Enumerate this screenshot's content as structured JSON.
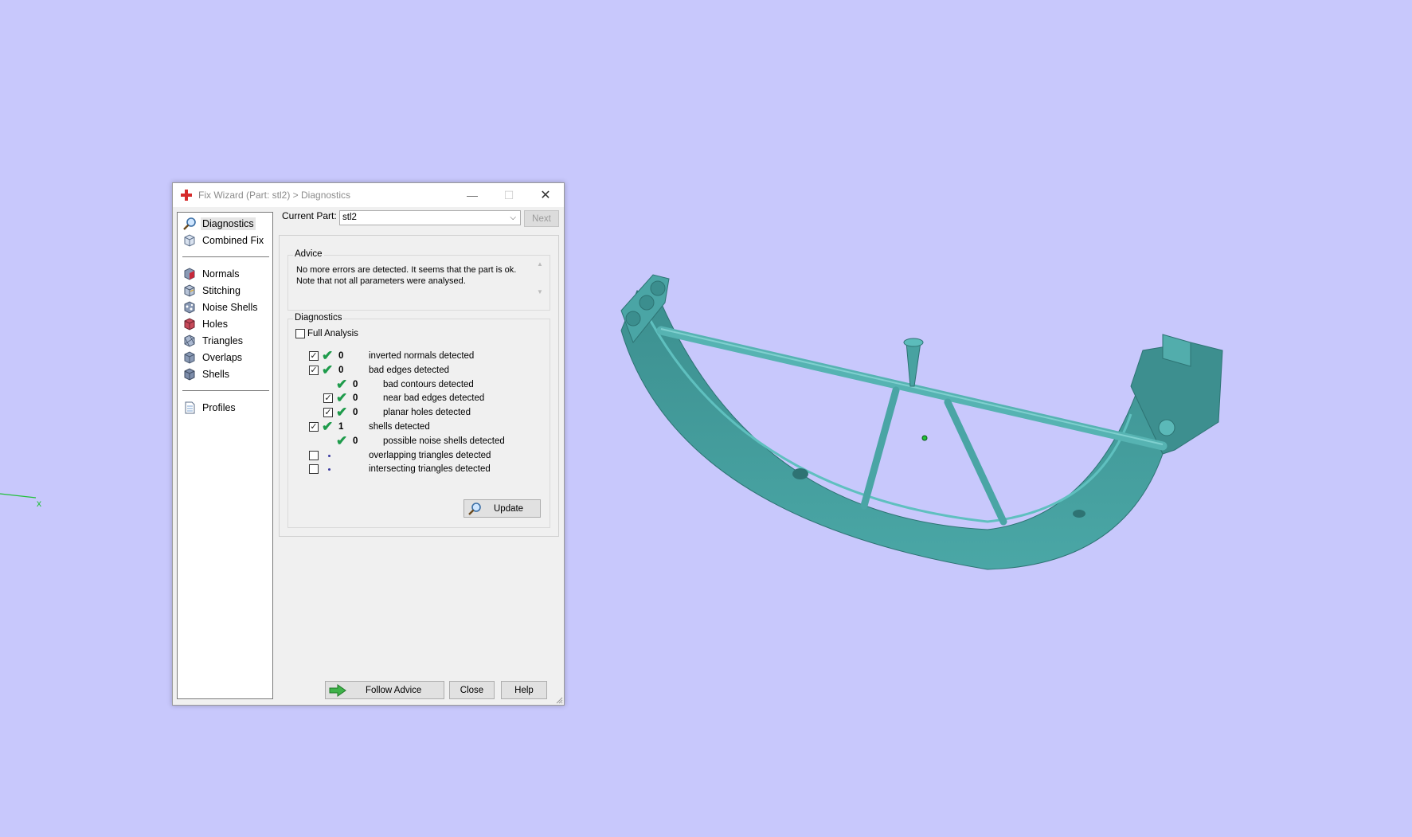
{
  "viewport": {
    "background": "#c8c8fc",
    "axis_label": "x",
    "model_color": "#3f9b9b"
  },
  "dialog": {
    "title": "Fix Wizard (Part: stl2) > Diagnostics",
    "app_icon": "red-cross-icon",
    "window_buttons": {
      "minimize": "—",
      "maximize": "☐",
      "close": "✕"
    }
  },
  "sidebar": {
    "items_top": [
      {
        "label": "Diagnostics",
        "icon": "magnifier-icon",
        "selected": true
      },
      {
        "label": "Combined Fix",
        "icon": "cube-icon"
      }
    ],
    "items_fix": [
      {
        "label": "Normals",
        "icon": "normals-cube-icon"
      },
      {
        "label": "Stitching",
        "icon": "stitching-cube-icon"
      },
      {
        "label": "Noise Shells",
        "icon": "noise-shells-icon"
      },
      {
        "label": "Holes",
        "icon": "holes-cube-icon"
      },
      {
        "label": "Triangles",
        "icon": "triangles-cube-icon"
      },
      {
        "label": "Overlaps",
        "icon": "overlaps-cube-icon"
      },
      {
        "label": "Shells",
        "icon": "shells-cube-icon"
      }
    ],
    "items_bottom": [
      {
        "label": "Profiles",
        "icon": "document-icon"
      }
    ]
  },
  "current_part": {
    "label": "Current Part:",
    "value": "stl2",
    "next_label": "Next"
  },
  "advice": {
    "title": "Advice",
    "text_line1": "No more errors are detected. It seems that the part is ok.",
    "text_line2": "Note that not all parameters were analysed."
  },
  "diagnostics": {
    "title": "Diagnostics",
    "full_analysis_label": "Full Analysis",
    "full_analysis_checked": false,
    "rows": [
      {
        "checkbox": true,
        "checked": true,
        "status": "ok",
        "count": "0",
        "label": "inverted normals detected",
        "indent": 0
      },
      {
        "checkbox": true,
        "checked": true,
        "status": "ok",
        "count": "0",
        "label": "bad edges detected",
        "indent": 0
      },
      {
        "checkbox": false,
        "checked": false,
        "status": "ok",
        "count": "0",
        "label": "bad contours detected",
        "indent": 1
      },
      {
        "checkbox": true,
        "checked": true,
        "status": "ok",
        "count": "0",
        "label": "near bad edges detected",
        "indent": 1
      },
      {
        "checkbox": true,
        "checked": true,
        "status": "ok",
        "count": "0",
        "label": "planar holes detected",
        "indent": 1
      },
      {
        "checkbox": true,
        "checked": true,
        "status": "ok",
        "count": "1",
        "label": "shells detected",
        "indent": 0
      },
      {
        "checkbox": false,
        "checked": false,
        "status": "ok",
        "count": "0",
        "label": "possible noise shells detected",
        "indent": 1
      },
      {
        "checkbox": true,
        "checked": false,
        "status": "none",
        "count": "",
        "label": "overlapping triangles detected",
        "indent": 0
      },
      {
        "checkbox": true,
        "checked": false,
        "status": "none",
        "count": "",
        "label": "intersecting triangles detected",
        "indent": 0
      }
    ],
    "update_label": "Update"
  },
  "footer": {
    "follow_advice_label": "Follow Advice",
    "close_label": "Close",
    "help_label": "Help"
  }
}
